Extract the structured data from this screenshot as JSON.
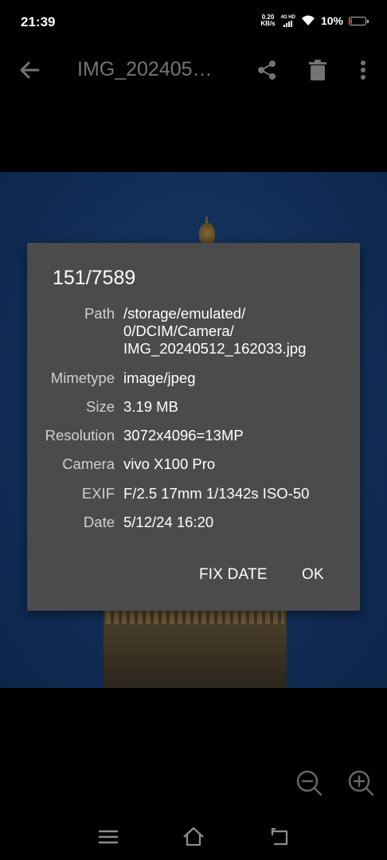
{
  "status_bar": {
    "time": "21:39",
    "net_speed_value": "0.20",
    "net_speed_unit": "KB/s",
    "network_type": "4G HD",
    "battery_percent": "10%",
    "battery_level": 0.1,
    "battery_color": "#e53935"
  },
  "toolbar": {
    "title": "IMG_202405…",
    "icons": [
      "back-arrow-icon",
      "share-icon",
      "delete-icon",
      "more-vert-icon"
    ]
  },
  "dialog": {
    "title": "151/7589",
    "rows": [
      {
        "label": "Path",
        "value_lines": [
          "/storage/emulated/",
          "0/DCIM/Camera/",
          "IMG_20240512_162033.jpg"
        ]
      },
      {
        "label": "Mimetype",
        "value": "image/jpeg"
      },
      {
        "label": "Size",
        "value": "3.19 MB"
      },
      {
        "label": "Resolution",
        "value": "3072x4096=13MP"
      },
      {
        "label": "Camera",
        "value": "vivo X100 Pro"
      },
      {
        "label": "EXIF",
        "value": "F/2.5 17mm 1/1342s ISO-50"
      },
      {
        "label": "Date",
        "value": "5/12/24 16:20"
      }
    ],
    "buttons": {
      "fix_date": "FIX DATE",
      "ok": "OK"
    }
  },
  "viewer_controls": [
    "zoom-out-icon",
    "zoom-in-icon"
  ],
  "nav_bar": [
    "menu-icon",
    "home-icon",
    "back-icon"
  ]
}
